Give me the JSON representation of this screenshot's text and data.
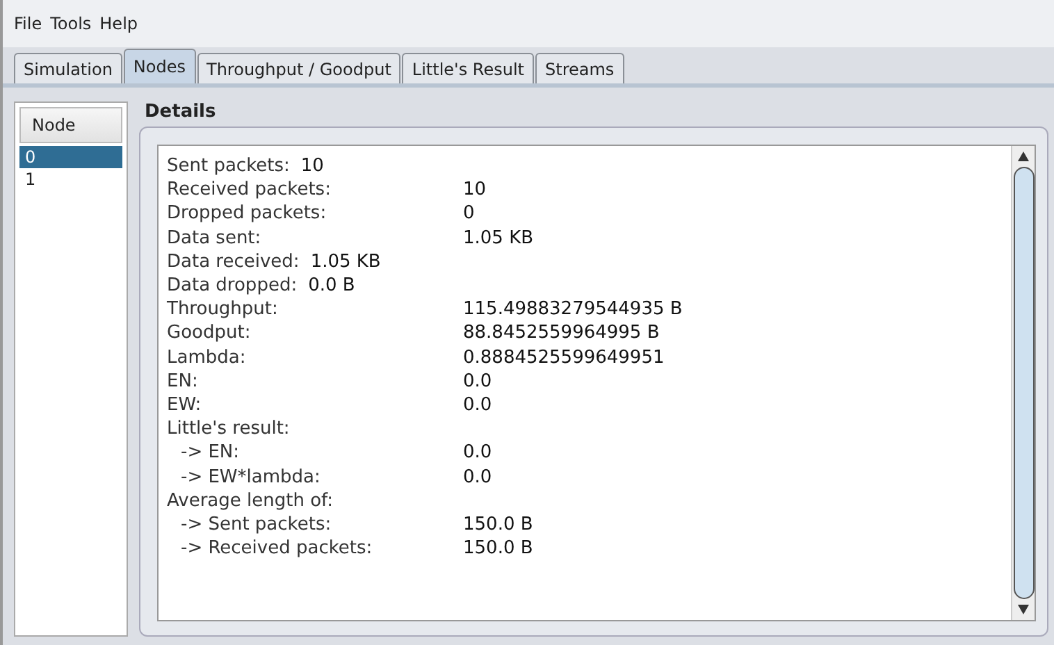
{
  "menu": [
    "File",
    "Tools",
    "Help"
  ],
  "tabs": [
    {
      "label": "Simulation",
      "selected": false
    },
    {
      "label": "Nodes",
      "selected": true
    },
    {
      "label": "Throughput / Goodput",
      "selected": false
    },
    {
      "label": "Little's Result",
      "selected": false
    },
    {
      "label": "Streams",
      "selected": false
    }
  ],
  "node_list": {
    "header": "Node",
    "items": [
      {
        "label": "0",
        "selected": true
      },
      {
        "label": "1",
        "selected": false
      }
    ]
  },
  "details": {
    "title": "Details",
    "rows": [
      {
        "label": "Sent packets:",
        "value": "10",
        "kind": "inline"
      },
      {
        "label": "Received packets:",
        "value": "10",
        "kind": "column"
      },
      {
        "label": "Dropped packets:",
        "value": "0",
        "kind": "column"
      },
      {
        "label": "Data sent:",
        "value": "1.05 KB",
        "kind": "column"
      },
      {
        "label": "Data received:",
        "value": "1.05 KB",
        "kind": "inline"
      },
      {
        "label": "Data dropped:",
        "value": "0.0 B",
        "kind": "inline"
      },
      {
        "label": "Throughput:",
        "value": "115.49883279544935 B",
        "kind": "column"
      },
      {
        "label": "Goodput:",
        "value": "88.8452559964995 B",
        "kind": "column"
      },
      {
        "label": "Lambda:",
        "value": "0.8884525599649951",
        "kind": "column"
      },
      {
        "label": "EN:",
        "value": "0.0",
        "kind": "column"
      },
      {
        "label": "EW:",
        "value": "0.0",
        "kind": "column"
      },
      {
        "label": "Little's result:",
        "kind": "column",
        "children": [
          {
            "label": "-> EN:",
            "value": "0.0"
          },
          {
            "label": "-> EW*lambda:",
            "value": "0.0"
          }
        ]
      },
      {
        "label": "Average length of:",
        "kind": "column",
        "children": [
          {
            "label": "-> Sent packets:",
            "value": "150.0 B"
          },
          {
            "label": "-> Received packets:",
            "value": "150.0 B"
          }
        ]
      }
    ]
  }
}
